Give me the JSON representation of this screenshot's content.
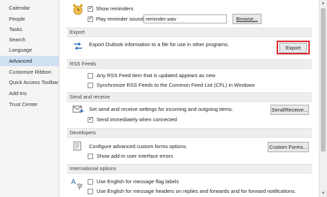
{
  "sidebar": {
    "items": [
      {
        "label": "Calendar"
      },
      {
        "label": "People"
      },
      {
        "label": "Tasks"
      },
      {
        "label": "Search"
      },
      {
        "label": "Language"
      },
      {
        "label": "Advanced",
        "active": true
      },
      {
        "label": "Customize Ribbon"
      },
      {
        "label": "Quick Access Toolbar"
      },
      {
        "label": "Add-Ins"
      },
      {
        "label": "Trust Center"
      }
    ]
  },
  "reminders": {
    "show_label": "Show reminders",
    "play_label": "Play reminder sound:",
    "sound_file": "reminder.wav",
    "browse_label": "Browse..."
  },
  "export": {
    "header": "Export",
    "description": "Export Outlook information to a file for use in other programs.",
    "button_label": "Export"
  },
  "rss": {
    "header": "RSS Feeds",
    "option1": "Any RSS Feed item that is updated appears as new",
    "option2": "Synchronize RSS Feeds to the Common Feed List (CFL) in Windows"
  },
  "send_receive": {
    "header": "Send and receive",
    "description": "Set send and receive settings for incoming and outgoing items.",
    "button_label": "Send/Receive...",
    "send_immediately": "Send immediately when connected"
  },
  "developers": {
    "header": "Developers",
    "description": "Configure advanced custom forms options.",
    "button_label": "Custom Forms...",
    "addin_errors": "Show add-in user interface errors"
  },
  "international": {
    "header": "International options",
    "option1": "Use English for message flag labels",
    "option2": "Use English for message headers on replies and forwards and for forward notifications."
  },
  "colors": {
    "accent_red": "#e0222a",
    "sidebar_active": "#cfe1f3"
  }
}
